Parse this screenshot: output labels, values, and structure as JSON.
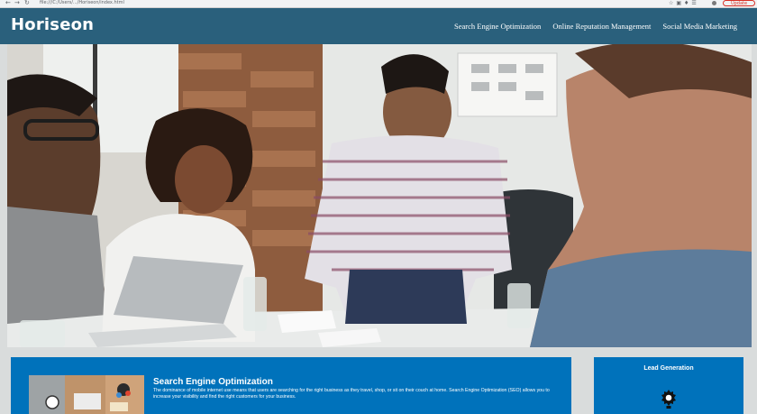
{
  "browser": {
    "url": "file:///C:/Users/.../Horiseon/index.html",
    "update_label": "Update"
  },
  "header": {
    "logo": "Horiseon",
    "nav": [
      {
        "label": "Search Engine Optimization"
      },
      {
        "label": "Online Reputation Management"
      },
      {
        "label": "Social Media Marketing"
      }
    ]
  },
  "hero": {
    "description": "Team meeting around a conference table"
  },
  "content": {
    "title": "Search Engine Optimization",
    "body": "The dominance of mobile internet use means that users are searching for the right business as they travel, shop, or sit on their couch at home. Search Engine Optimization (SEO) allows you to increase your visibility and find the right customers for your business."
  },
  "benefits": {
    "title": "Lead Generation",
    "icon": "gear-lightbulb-icon"
  },
  "colors": {
    "header_bg": "#2a607c",
    "card_bg": "#0072bb",
    "page_bg": "#d9dcdc"
  }
}
